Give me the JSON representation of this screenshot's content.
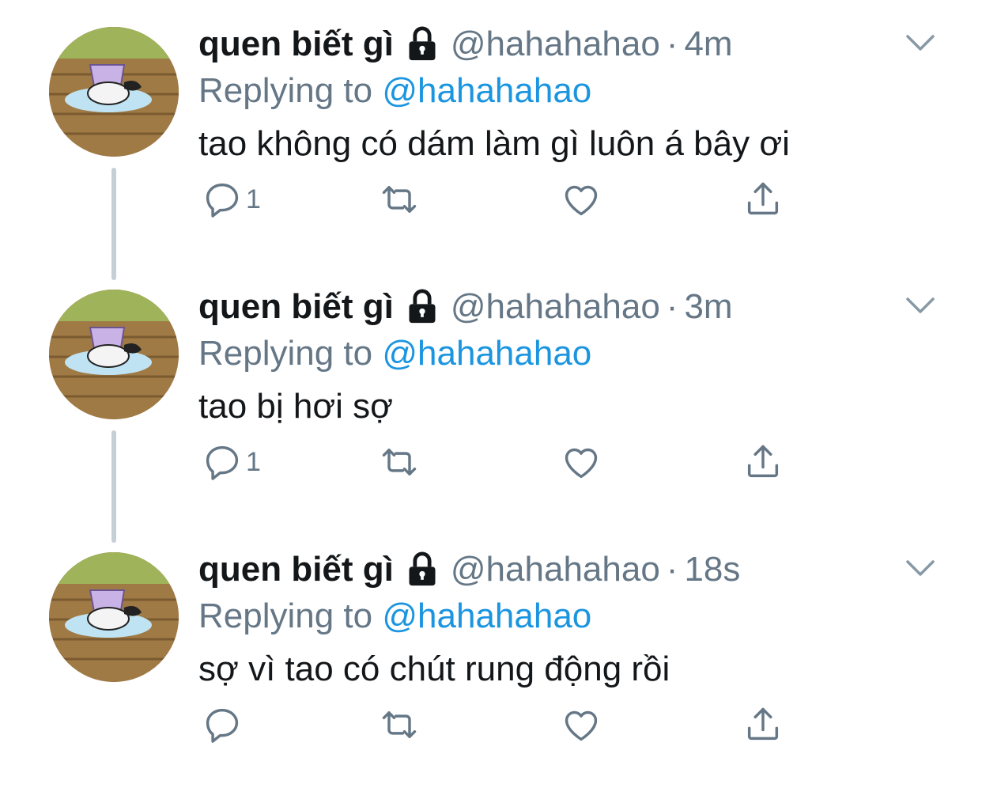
{
  "colors": {
    "name": "#14171a",
    "muted": "#657786",
    "link": "#1b95e0",
    "thread_line": "#c4cfd6"
  },
  "tweets": [
    {
      "name": "quen biết gì",
      "handle": "@hahahahao",
      "separator": "·",
      "time": "4m",
      "reply_prefix": "Replying to",
      "reply_to": "@hahahahao",
      "text": "tao không có dám làm gì luôn á bây ơi",
      "reply_count": "1",
      "icons": [
        "lock-icon",
        "reply-icon",
        "retweet-icon",
        "like-icon",
        "share-icon",
        "chevron-down-icon"
      ]
    },
    {
      "name": "quen biết gì",
      "handle": "@hahahahao",
      "separator": "·",
      "time": "3m",
      "reply_prefix": "Replying to",
      "reply_to": "@hahahahao",
      "text": "tao bị hơi sợ",
      "reply_count": "1",
      "icons": [
        "lock-icon",
        "reply-icon",
        "retweet-icon",
        "like-icon",
        "share-icon",
        "chevron-down-icon"
      ]
    },
    {
      "name": "quen biết gì",
      "handle": "@hahahahao",
      "separator": "·",
      "time": "18s",
      "reply_prefix": "Replying to",
      "reply_to": "@hahahahao",
      "text": "sợ vì tao có chút rung động rồi",
      "reply_count": "",
      "icons": [
        "lock-icon",
        "reply-icon",
        "retweet-icon",
        "like-icon",
        "share-icon",
        "chevron-down-icon"
      ]
    }
  ]
}
